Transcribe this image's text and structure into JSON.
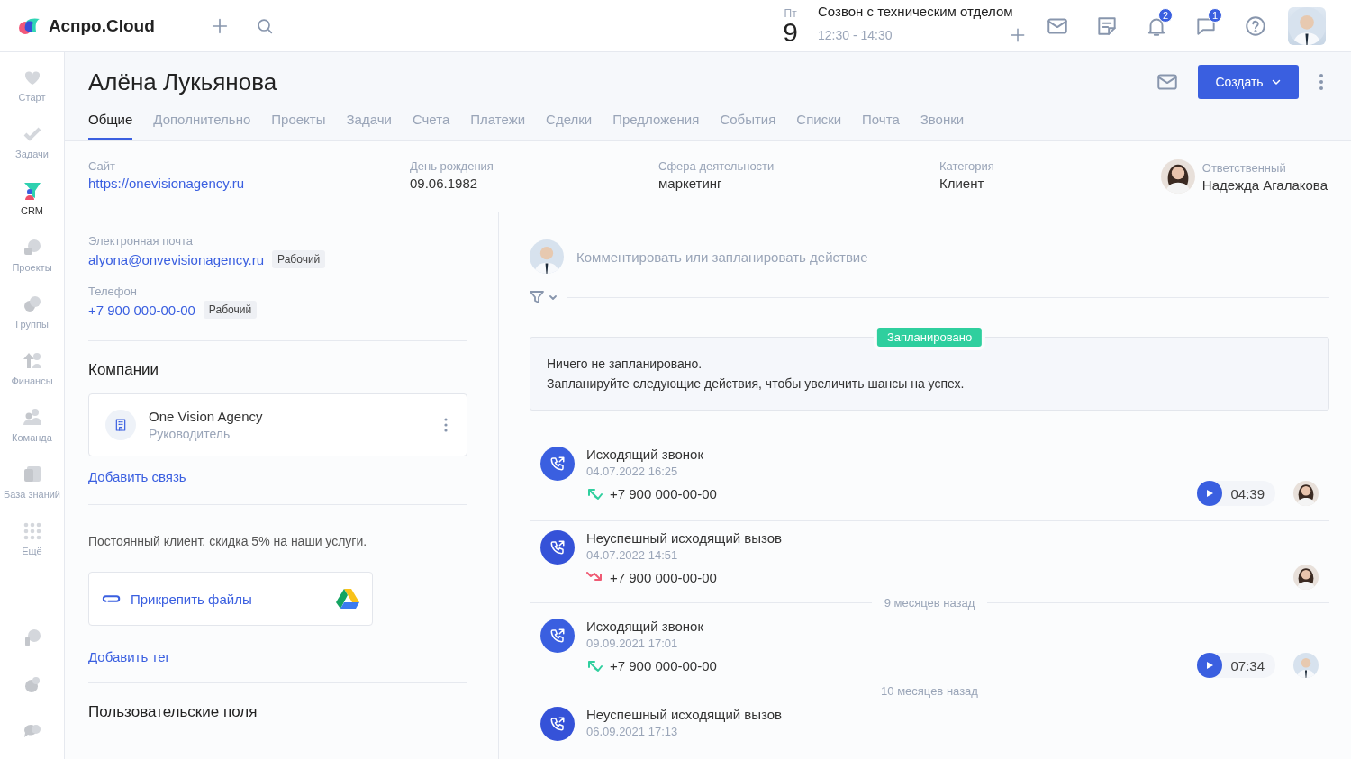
{
  "topbar": {
    "logo": "Аспро.Cloud",
    "event": {
      "weekday": "Пт",
      "day": "9",
      "title": "Созвон с техническим отделом",
      "time": "12:30 - 14:30"
    },
    "icons": [
      {
        "kind": "mail"
      },
      {
        "kind": "notes"
      },
      {
        "kind": "bell",
        "badge": "2"
      },
      {
        "kind": "chat",
        "badge": "1"
      },
      {
        "kind": "help"
      }
    ]
  },
  "sidebar": {
    "items": [
      {
        "label": "Старт",
        "selected": false
      },
      {
        "label": "Задачи",
        "selected": false
      },
      {
        "label": "CRM",
        "selected": true
      },
      {
        "label": "Проекты",
        "selected": false
      },
      {
        "label": "Группы",
        "selected": false
      },
      {
        "label": "Финансы",
        "selected": false
      },
      {
        "label": "Команда",
        "selected": false
      },
      {
        "label": "База знаний",
        "selected": false
      },
      {
        "label": "Ещё",
        "selected": false
      }
    ]
  },
  "contact": {
    "name": "Алёна Лукьянова",
    "create_button": "Создать",
    "tabs": [
      {
        "label": "Общие",
        "selected": true
      },
      {
        "label": "Дополнительно",
        "selected": false
      },
      {
        "label": "Проекты",
        "selected": false
      },
      {
        "label": "Задачи",
        "selected": false
      },
      {
        "label": "Счета",
        "selected": false
      },
      {
        "label": "Платежи",
        "selected": false
      },
      {
        "label": "Сделки",
        "selected": false
      },
      {
        "label": "Предложения",
        "selected": false
      },
      {
        "label": "События",
        "selected": false
      },
      {
        "label": "Списки",
        "selected": false
      },
      {
        "label": "Почта",
        "selected": false
      },
      {
        "label": "Звонки",
        "selected": false
      }
    ],
    "info": [
      {
        "label": "Сайт",
        "value": "https://onevisionagency.ru",
        "kind": "link"
      },
      {
        "label": "День рождения",
        "value": "09.06.1982",
        "kind": "text"
      },
      {
        "label": "Сфера деятельности",
        "value": "маркетинг",
        "kind": "text"
      },
      {
        "label": "Категория",
        "value": "Клиент",
        "kind": "text"
      },
      {
        "label": "Ответственный",
        "value": "Надежда Агалакова",
        "kind": "person"
      }
    ]
  },
  "details": {
    "contacts": [
      {
        "label": "Электронная почта",
        "value": "alyona@onvevisionagency.ru",
        "tag": "Рабочий"
      },
      {
        "label": "Телефон",
        "value": "+7 900 000-00-00",
        "tag": "Рабочий"
      }
    ],
    "companies_title": "Компании",
    "company": {
      "name": "One Vision Agency",
      "role": "Руководитель"
    },
    "add_link": "Добавить связь",
    "note": "Постоянный клиент, скидка 5% на наши услуги.",
    "attach": "Прикрепить файлы",
    "add_tag": "Добавить тег",
    "custom_fields_title": "Пользовательские поля"
  },
  "feed": {
    "comment_placeholder": "Комментировать или запланировать действие",
    "planned_badge": "Запланировано",
    "planned_lines": [
      "Ничего не запланировано.",
      "Запланируйте следующие действия, чтобы увеличить шансы на успех."
    ],
    "items": [
      {
        "kind": "call",
        "title": "Исходящий звонок",
        "date": "04.07.2022 16:25",
        "phone": "+7 900 000-00-00",
        "success": true,
        "duration": "04:39"
      },
      {
        "kind": "call",
        "title": "Неуспешный исходящий вызов",
        "date": "04.07.2022 14:51",
        "phone": "+7 900 000-00-00",
        "success": false
      },
      {
        "kind": "separator",
        "label": "9 месяцев назад"
      },
      {
        "kind": "call",
        "title": "Исходящий звонок",
        "date": "09.09.2021 17:01",
        "phone": "+7 900 000-00-00",
        "success": true,
        "duration": "07:34"
      },
      {
        "kind": "separator",
        "label": "10 месяцев назад"
      },
      {
        "kind": "call",
        "title": "Неуспешный исходящий вызов",
        "date": "06.09.2021 17:13",
        "success": false
      }
    ]
  }
}
